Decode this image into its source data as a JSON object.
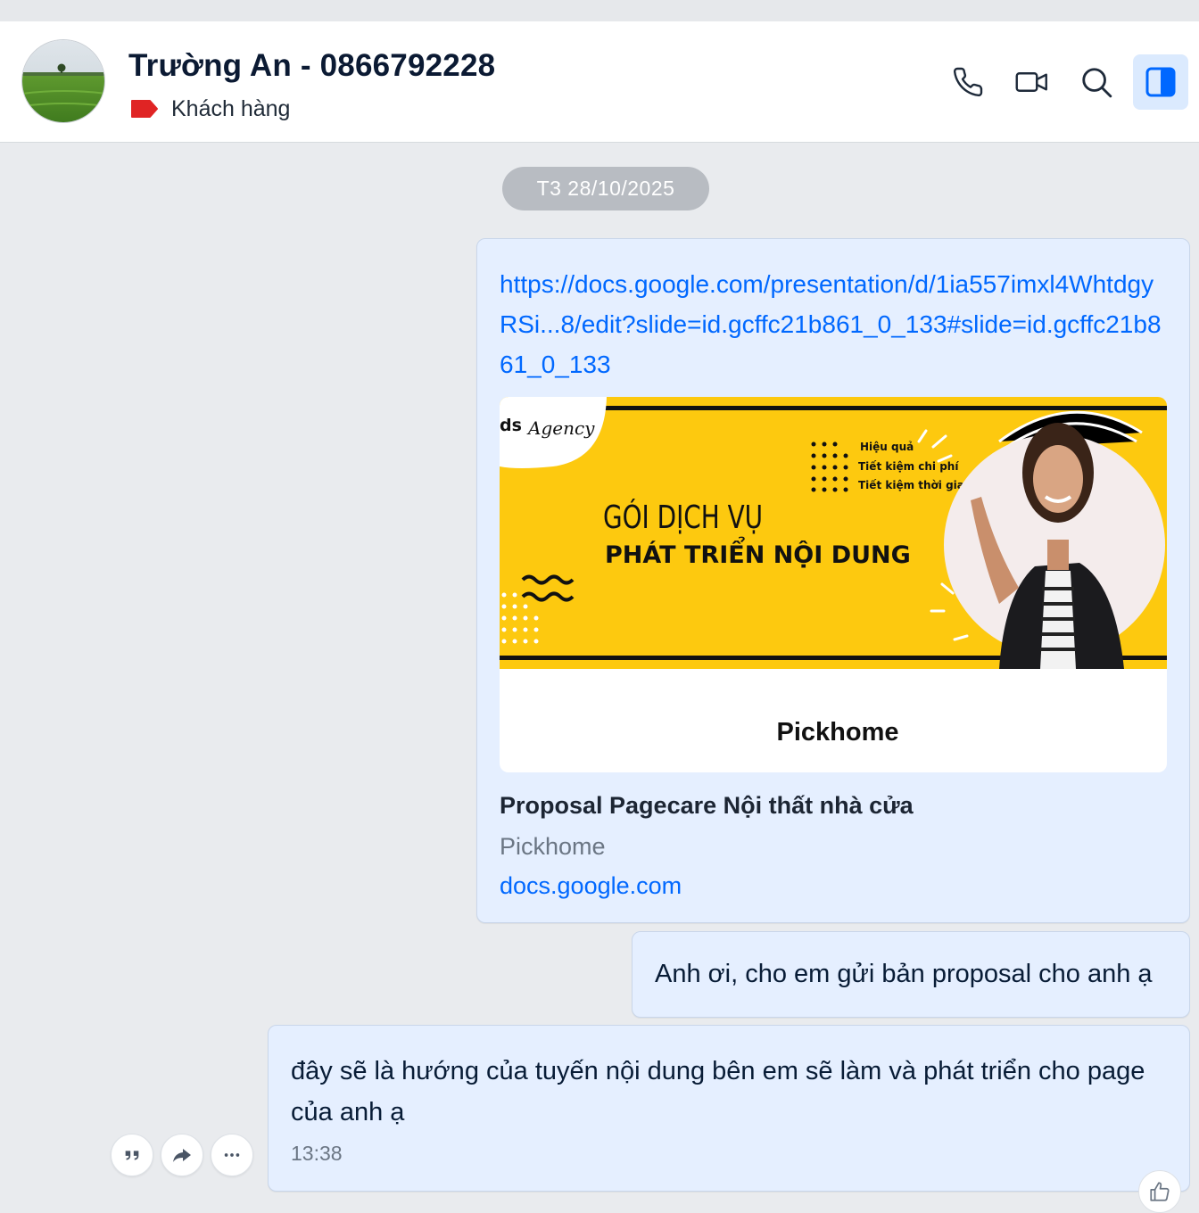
{
  "header": {
    "contact_name": "Trường An - 0866792228",
    "tag_label": "Khách hàng",
    "tag_color": "#e02424",
    "accent_color": "#0068ff",
    "icons": [
      "phone-icon",
      "video-camera-icon",
      "search-icon",
      "sidebar-toggle-icon"
    ]
  },
  "conversation": {
    "date_divider": "T3 28/10/2025",
    "messages": [
      {
        "type": "link",
        "link_text": "https://docs.google.com/presentation/d/1ia557imxl4WhtdgyRSi...8/edit?slide=id.gcffc21b861_0_133#slide=id.gcffc21b861_0_133",
        "preview": {
          "banner": {
            "brand": "ds",
            "brand_script": "Agency",
            "bullets": [
              "Hiệu quả",
              "Tiết kiệm chi phí",
              "Tiết kiệm thời gian"
            ],
            "heading_line1": "GÓI DỊCH VỤ",
            "heading_line2": "PHÁT TRIỂN NỘI DUNG",
            "banner_color": "#fdc90f"
          },
          "label": "Pickhome",
          "title": "Proposal Pagecare Nội thất nhà cửa",
          "subtitle": "Pickhome",
          "domain": "docs.google.com"
        }
      },
      {
        "type": "text",
        "text": "Anh ơi, cho em gửi bản proposal cho anh ạ"
      },
      {
        "type": "text",
        "text": "đây sẽ là hướng của tuyến nội dung bên em sẽ làm và phát triển cho page của anh ạ",
        "time": "13:38"
      }
    ],
    "message_actions": [
      "quote-icon",
      "forward-icon",
      "more-icon"
    ],
    "reaction_icon": "thumbs-up-icon"
  }
}
